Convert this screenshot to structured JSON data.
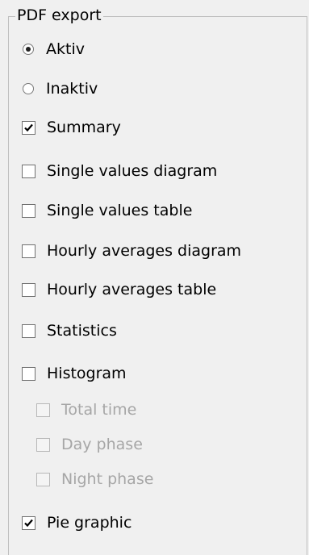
{
  "group": {
    "title": "PDF export"
  },
  "radios": [
    {
      "label": "Aktiv",
      "selected": true
    },
    {
      "label": "Inaktiv",
      "selected": false
    }
  ],
  "checkboxes": [
    {
      "label": "Summary",
      "checked": true,
      "enabled": true
    },
    {
      "label": "Single values diagram",
      "checked": false,
      "enabled": true
    },
    {
      "label": "Single values table",
      "checked": false,
      "enabled": true
    },
    {
      "label": "Hourly averages diagram",
      "checked": false,
      "enabled": true
    },
    {
      "label": "Hourly averages table",
      "checked": false,
      "enabled": true
    },
    {
      "label": "Statistics",
      "checked": false,
      "enabled": true
    },
    {
      "label": "Histogram",
      "checked": false,
      "enabled": true
    },
    {
      "label": "Total time",
      "checked": false,
      "enabled": false
    },
    {
      "label": "Day phase",
      "checked": false,
      "enabled": false
    },
    {
      "label": "Night phase",
      "checked": false,
      "enabled": false
    },
    {
      "label": "Pie graphic",
      "checked": true,
      "enabled": true
    }
  ]
}
